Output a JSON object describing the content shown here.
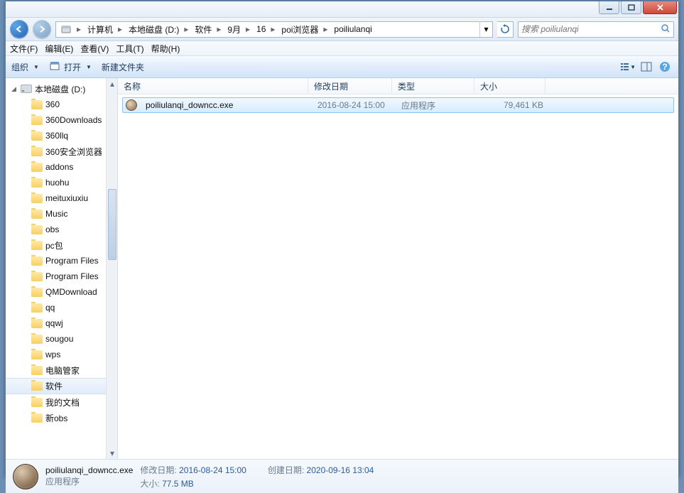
{
  "title_buttons": {
    "min": "minimize",
    "max": "maximize",
    "close": "close"
  },
  "breadcrumb": {
    "items": [
      "计算机",
      "本地磁盘 (D:)",
      "软件",
      "9月",
      "16",
      "poi浏览器",
      "poiliulanqi"
    ]
  },
  "search": {
    "placeholder": "搜索 poiliulanqi"
  },
  "menu": {
    "file": "文件(F)",
    "edit": "编辑(E)",
    "view": "查看(V)",
    "tools": "工具(T)",
    "help": "帮助(H)"
  },
  "toolbar": {
    "organize": "组织",
    "open": "打开",
    "newfolder": "新建文件夹"
  },
  "sidebar": {
    "drive": "本地磁盘 (D:)",
    "items": [
      "360",
      "360Downloads",
      "360llq",
      "360安全浏览器",
      "addons",
      "huohu",
      "meituxiuxiu",
      "Music",
      "obs",
      "pc包",
      "Program Files",
      "Program Files",
      "QMDownload",
      "qq",
      "qqwj",
      "sougou",
      "wps",
      "电脑管家",
      "软件",
      "我的文档",
      "新obs"
    ],
    "selected_index": 18
  },
  "columns": {
    "name": "名称",
    "modified": "修改日期",
    "type": "类型",
    "size": "大小"
  },
  "files": [
    {
      "name": "poiliulanqi_downcc.exe",
      "modified": "2016-08-24 15:00",
      "type": "应用程序",
      "size": "79,461 KB"
    }
  ],
  "details": {
    "filename": "poiliulanqi_downcc.exe",
    "filetype": "应用程序",
    "mod_label": "修改日期:",
    "mod_value": "2016-08-24 15:00",
    "size_label": "大小:",
    "size_value": "77.5 MB",
    "created_label": "创建日期:",
    "created_value": "2020-09-16 13:04"
  }
}
